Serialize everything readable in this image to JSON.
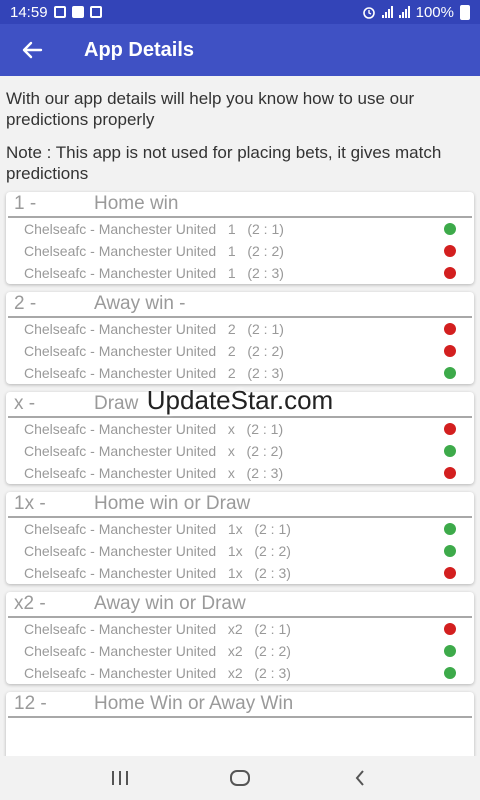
{
  "status": {
    "time": "14:59",
    "battery": "100%"
  },
  "header": {
    "title": "App Details"
  },
  "intro": "With our app details will help you know how to use our predictions properly",
  "note": "Note : This app is not used for placing bets, it gives match predictions",
  "colors": {
    "green": "#3daa4a",
    "red": "#d31f1f",
    "appbar": "#3f51c4",
    "statusbar": "#3344b8"
  },
  "cards": [
    {
      "code": "1 -",
      "title": "Home win",
      "rows": [
        {
          "text": "Chelseafc - Manchester United   1   (2 : 1)",
          "status": "green"
        },
        {
          "text": "Chelseafc - Manchester United   1   (2 : 2)",
          "status": "red"
        },
        {
          "text": "Chelseafc - Manchester United   1   (2 : 3)",
          "status": "red"
        }
      ]
    },
    {
      "code": "2 -",
      "title": "Away win -",
      "rows": [
        {
          "text": "Chelseafc - Manchester United   2   (2 : 1)",
          "status": "red"
        },
        {
          "text": "Chelseafc - Manchester United   2   (2 : 2)",
          "status": "red"
        },
        {
          "text": "Chelseafc - Manchester United   2   (2 : 3)",
          "status": "green"
        }
      ]
    },
    {
      "code": "x -",
      "title": "Draw",
      "rows": [
        {
          "text": "Chelseafc - Manchester United   x   (2 : 1)",
          "status": "red"
        },
        {
          "text": "Chelseafc - Manchester United   x   (2 : 2)",
          "status": "green"
        },
        {
          "text": "Chelseafc - Manchester United   x   (2 : 3)",
          "status": "red"
        }
      ]
    },
    {
      "code": "1x -",
      "title": "Home win or Draw",
      "rows": [
        {
          "text": "Chelseafc - Manchester United   1x   (2 : 1)",
          "status": "green"
        },
        {
          "text": "Chelseafc - Manchester United   1x   (2 : 2)",
          "status": "green"
        },
        {
          "text": "Chelseafc - Manchester United   1x   (2 : 3)",
          "status": "red"
        }
      ]
    },
    {
      "code": "x2 -",
      "title": "Away win or Draw",
      "rows": [
        {
          "text": "Chelseafc - Manchester United   x2   (2 : 1)",
          "status": "red"
        },
        {
          "text": "Chelseafc - Manchester United   x2   (2 : 2)",
          "status": "green"
        },
        {
          "text": "Chelseafc - Manchester United   x2   (2 : 3)",
          "status": "green"
        }
      ]
    },
    {
      "code": "12 -",
      "title": "Home Win or Away Win",
      "rows": []
    }
  ],
  "watermark": "UpdateStar.com",
  "icons": {
    "back": "arrow-left-icon",
    "recents": "recents-icon",
    "home": "home-icon",
    "nav_back": "chevron-left-icon"
  }
}
